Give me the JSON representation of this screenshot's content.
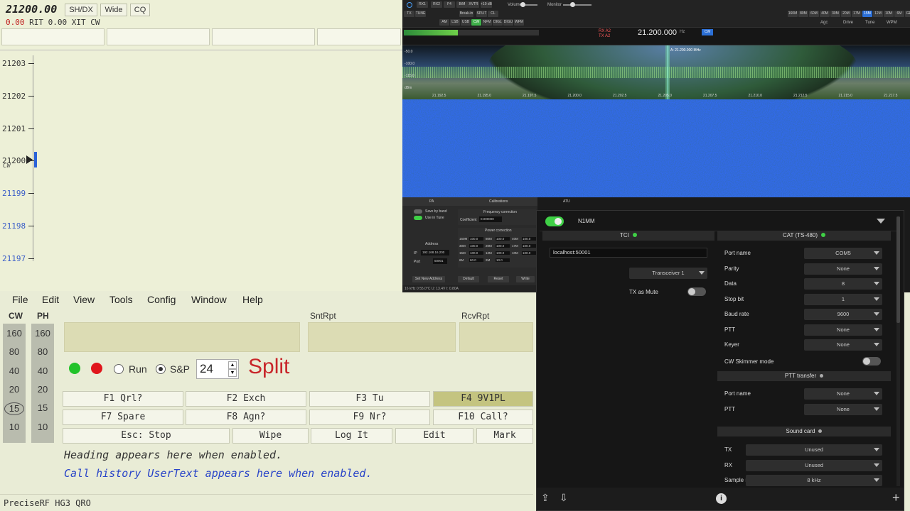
{
  "bandmap": {
    "frequency": "21200.00",
    "buttons": [
      "SH/DX",
      "Wide",
      "CQ"
    ],
    "rit_value": "0.00",
    "rit_label": "RIT",
    "xit_value": "0.00",
    "xit_label": "XIT",
    "mode": "CW",
    "marker_mode": "CW",
    "ticks": [
      {
        "label": "21203",
        "lower": false
      },
      {
        "label": "21202",
        "lower": false
      },
      {
        "label": "21201",
        "lower": false
      },
      {
        "label": "21200",
        "lower": false
      },
      {
        "label": "21199",
        "lower": true
      },
      {
        "label": "21198",
        "lower": true
      },
      {
        "label": "21197",
        "lower": true
      }
    ]
  },
  "entry": {
    "menu": [
      "File",
      "Edit",
      "View",
      "Tools",
      "Config",
      "Window",
      "Help"
    ],
    "col_cw": "CW",
    "col_ph": "PH",
    "bands": [
      "160",
      "80",
      "40",
      "20",
      "15",
      "10"
    ],
    "selected_band": "15",
    "field_labels": {
      "snt": "SntRpt",
      "rcv": "RcvRpt"
    },
    "run_label": "Run",
    "sp_label": "S&P",
    "radio_selected": "S&P",
    "spinner_value": "24",
    "split_label": "Split",
    "fkeys_row1": [
      "F1 Qrl?",
      "F2 Exch",
      "F3 Tu",
      "F4 9V1PL"
    ],
    "fkeys_row2": [
      "F7 Spare",
      "F8 Agn?",
      "F9 Nr?",
      "F10 Call?"
    ],
    "buttons_row3": [
      "Esc: Stop",
      "Wipe",
      "Log It",
      "Edit",
      "Mark"
    ],
    "heading_text": "Heading appears here when enabled.",
    "call_history_text": "Call history UserText appears here when enabled.",
    "status": "PreciseRF HG3 QRO",
    "colors": {
      "split": "#c8262a",
      "call_history": "#2944c8",
      "green_dot": "#22c32a",
      "red_dot": "#e0161c"
    }
  },
  "sdr": {
    "vfo_frequency": "21.200.000",
    "vfo_unit": "Hz",
    "mode_badge": "CW",
    "rx_label": "RX A2",
    "tx_label": "TX A2",
    "marker_label": "A: 21.200.000 MHz",
    "bands": [
      "160M",
      "80M",
      "60M",
      "40M",
      "30M",
      "20M",
      "17M",
      "15M",
      "12M",
      "10M",
      "6M",
      "GEN"
    ],
    "selected_band": "15M",
    "top_buttons": [
      "RX1",
      "RX2",
      "F4",
      "B/M",
      "XVTR",
      "+10 dB"
    ],
    "row2_buttons": [
      "TX",
      "TUNE",
      "Break-in",
      "SPLIT",
      "CL"
    ],
    "volume_label": "Volume",
    "monitor_label": "Monitor",
    "modes": [
      "AM",
      "LSB",
      "USB",
      "CW",
      "NFM",
      "DIGL",
      "DIGU",
      "WFM"
    ],
    "selected_mode": "CW",
    "agc_label": "Agc",
    "drive_label": "Drive",
    "tune_label": "Tune",
    "wpm_label": "WPM",
    "freq_ticks": [
      "21.192.5",
      "21.195.0",
      "21.197.5",
      "21.200.0",
      "21.202.5",
      "21.205.0",
      "21.207.5",
      "21.210.0",
      "21.212.5",
      "21.215.0",
      "21.217.5"
    ],
    "spectrum_db_labels": [
      "-50.0",
      "-100.0",
      "-115.0",
      "dBm"
    ],
    "settings_tabs": [
      "PA",
      "Calibrations",
      "ATU"
    ],
    "settings_items": [
      "Save by band",
      "Use in Tune"
    ],
    "freq_correction_label": "Frequency correction",
    "coefficient_label": "Coefficient",
    "coefficient_value": "0.000000",
    "power_correction_label": "Power correction",
    "address_label": "Address",
    "ip_label": "IP",
    "ip_value": "192.168.16.200",
    "port_label": "Port",
    "port_value": "50001",
    "power_rows": [
      [
        "160M",
        "100.0",
        "80M",
        "100.0",
        "40M",
        "100.0"
      ],
      [
        "30M",
        "100.0",
        "20M",
        "100.0",
        "17M",
        "100.0"
      ],
      [
        "15M",
        "100.0",
        "12M",
        "100.0",
        "10M",
        "100.0"
      ],
      [
        "6M",
        "60.0",
        "2M",
        "10.0",
        "",
        ""
      ]
    ],
    "settings_buttons": [
      "Set New Address",
      "Default",
      "Reset",
      "Write"
    ],
    "status_bar": "16 kHz   0   55.0°C   U: 13.4V   I: 0.80A"
  },
  "tci": {
    "title": "N1MM",
    "tci_header": "TCI",
    "tci_address": "localhost:50001",
    "transceiver": "Transceiver 1",
    "tx_as_mute_label": "TX as Mute",
    "cat_header": "CAT (TS-480)",
    "cat_rows": [
      {
        "label": "Port name",
        "value": "COM5"
      },
      {
        "label": "Parity",
        "value": "None"
      },
      {
        "label": "Data",
        "value": "8"
      },
      {
        "label": "Stop bit",
        "value": "1"
      },
      {
        "label": "Baud rate",
        "value": "9600"
      },
      {
        "label": "PTT",
        "value": "None"
      },
      {
        "label": "Keyer",
        "value": "None"
      }
    ],
    "cw_skimmer_label": "CW Skimmer mode",
    "ptt_transfer_header": "PTT transfer",
    "ptt_rows": [
      {
        "label": "Port name",
        "value": "None"
      },
      {
        "label": "PTT",
        "value": "None"
      }
    ],
    "sound_card_header": "Sound card",
    "sound_rows": [
      {
        "label": "TX",
        "value": "Unused"
      },
      {
        "label": "RX",
        "value": "Unused"
      },
      {
        "label": "Sample rate",
        "value": "8 kHz"
      }
    ]
  }
}
